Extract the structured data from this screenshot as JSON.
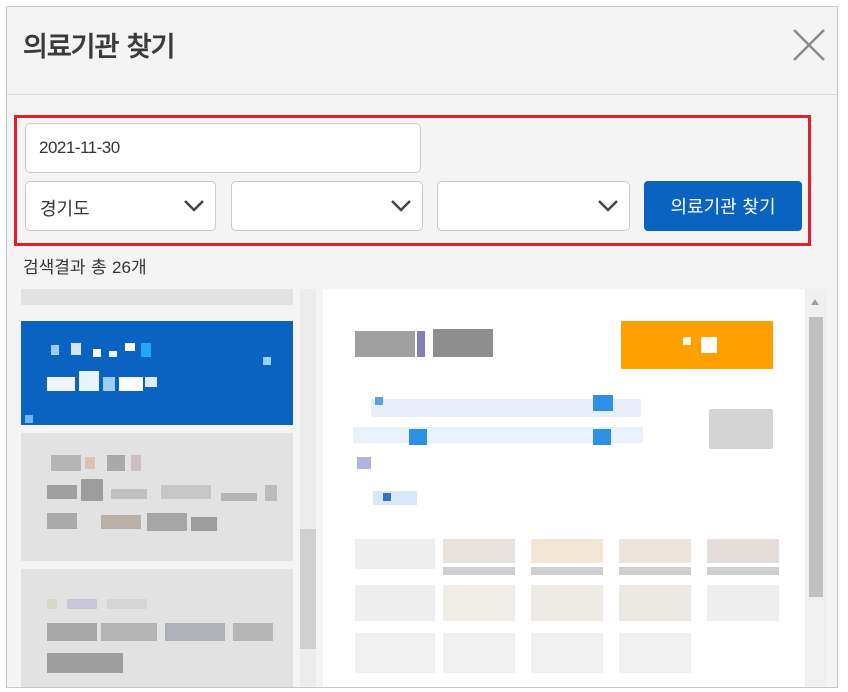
{
  "modal": {
    "title": "의료기관 찾기",
    "close_icon": "close-icon"
  },
  "filters": {
    "date_value": "2021-11-30",
    "region_value": "경기도",
    "district_value": "",
    "town_value": "",
    "search_button_label": "의료기관 찾기"
  },
  "results": {
    "count_prefix": "검색결과 총 ",
    "count_value": "26",
    "count_suffix": "개"
  },
  "colors": {
    "accent_blue": "#0b63c1",
    "highlight_red": "#e0202a",
    "badge_orange": "#ff9f00"
  }
}
